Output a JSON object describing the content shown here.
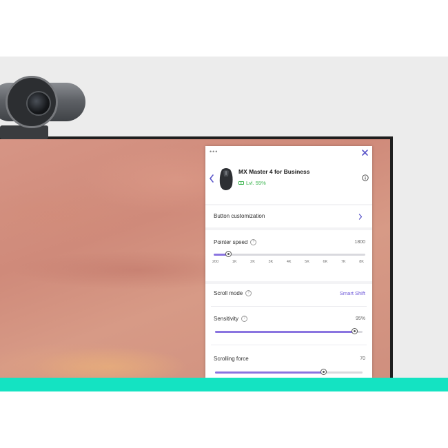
{
  "device": {
    "name": "MX Master 4 for Business",
    "battery": "Lvl. 55%"
  },
  "panel": {
    "menu_icon": "more-dots-icon",
    "close_icon": "close-icon",
    "back_icon": "chevron-left-icon",
    "info_icon": "info-icon"
  },
  "button_customization": {
    "label": "Button customization",
    "icon": "chevron-right-icon"
  },
  "pointer_speed": {
    "label": "Pointer speed",
    "help_icon": "help-icon",
    "value": "1800",
    "level_fraction": 0.1,
    "ticks": [
      "200",
      "1K",
      "2K",
      "3K",
      "4K",
      "5K",
      "6K",
      "7K",
      "8K"
    ]
  },
  "scroll_mode": {
    "label": "Scroll mode",
    "help_icon": "help-icon",
    "value": "Smart Shift"
  },
  "sensitivity": {
    "label": "Sensitivity",
    "help_icon": "help-icon",
    "value": "95%",
    "level_fraction": 0.95
  },
  "scrolling_force": {
    "label": "Scrolling force",
    "value": "70",
    "level_fraction": 0.74
  },
  "colors": {
    "accent": "#8a74e0",
    "accent_text": "#6d57d8",
    "battery_green": "#36b24a",
    "teal_strip": "#14e3c2"
  }
}
